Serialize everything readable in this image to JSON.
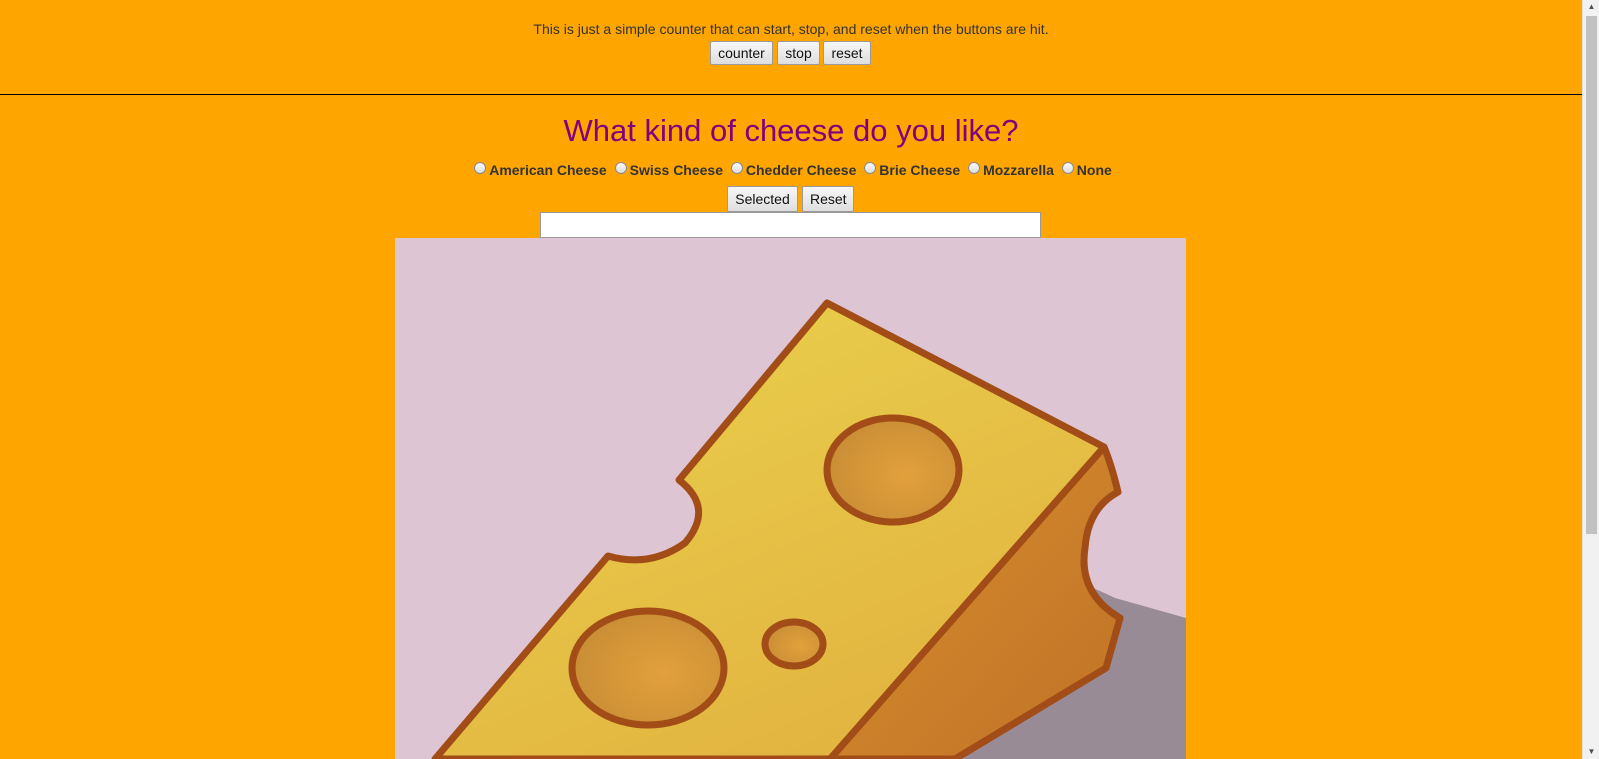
{
  "counter_section": {
    "description": "This is just a simple counter that can start, stop, and reset when the buttons are hit.",
    "buttons": {
      "counter": "counter",
      "stop": "stop",
      "reset": "reset"
    }
  },
  "cheese_form": {
    "question": "What kind of cheese do you like?",
    "options": [
      "American Cheese",
      "Swiss Cheese",
      "Chedder Cheese",
      "Brie Cheese",
      "Mozzarella",
      "None"
    ],
    "buttons": {
      "selected": "Selected",
      "reset": "Reset"
    },
    "result_value": ""
  },
  "colors": {
    "page_background": "#FFA500",
    "heading": "#800080",
    "image_background": "#DDC5D3",
    "cheese_fill": "#E6C24A",
    "cheese_outline": "#A24C17"
  },
  "icons": {
    "image": "cheese-wedge-illustration",
    "scroll_up": "scroll-up-arrow-icon",
    "scroll_down": "scroll-down-arrow-icon"
  }
}
